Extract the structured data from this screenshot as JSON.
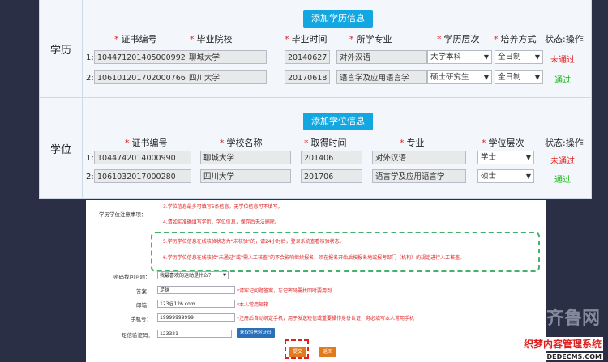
{
  "education": {
    "section_label": "学历",
    "add_button": "添加学历信息",
    "headers": [
      "证书编号",
      "毕业院校",
      "毕业时间",
      "所学专业",
      "学历层次",
      "培养方式",
      "状态:操作"
    ],
    "rows": [
      {
        "num": "1:",
        "cert": "104471201405000992",
        "school": "聊城大学",
        "date": "20140627",
        "major": "对外汉语",
        "level": "大学本科",
        "mode": "全日制",
        "status": "未通过",
        "status_ok": false
      },
      {
        "num": "2:",
        "cert": "106101201702000766",
        "school": "四川大学",
        "date": "20170618",
        "major": "语言学及应用语言学",
        "level": "硕士研究生",
        "mode": "全日制",
        "status": "通过",
        "status_ok": true
      }
    ]
  },
  "degree": {
    "section_label": "学位",
    "add_button": "添加学位信息",
    "headers": [
      "证书编号",
      "学校名称",
      "取得时间",
      "专业",
      "学位层次",
      "状态:操作"
    ],
    "rows": [
      {
        "num": "1:",
        "cert": "1044742014000990",
        "school": "聊城大学",
        "date": "201406",
        "major": "对外汉语",
        "level": "学士",
        "status": "未通过",
        "status_ok": false
      },
      {
        "num": "2:",
        "cert": "1061032017000280",
        "school": "四川大学",
        "date": "201706",
        "major": "语言学及应用语言学",
        "level": "硕士",
        "status": "通过",
        "status_ok": true
      }
    ]
  },
  "form": {
    "notice_label": "学历学位注意事项：",
    "notes": [
      "3.学位信息最多可填写5条信息，无学位信息可不填写。",
      "4.请如实准确填写学历、学位信息，保存后无法删除。",
      "5.学历学位信息在线核验状态为“未核验”的，请24小时后，登录系统查看核验状态。",
      "6.学历学位信息在线核验“未通过”或“需人工核查”的不会影响继续报名，须在报名开始后按报名地或报考部门（机构）的规定进行人工核查。"
    ],
    "question_label": "密码找回问题：",
    "question_value": "我最喜欢的运动是什么？",
    "answer_label": "答案：",
    "answer_value": "足球",
    "answer_hint": "*请牢记问题答案，忘记密码需找回时要用到",
    "email_label": "邮箱：",
    "email_value": "123@126.com",
    "email_hint": "*本人常用邮箱",
    "phone_label": "手机号：",
    "phone_value": "19999999999",
    "phone_hint": "*注册后自动绑定手机，用于发送短信或重要操作身份认证，务必填写本人常用手机",
    "code_label": "短信验证码：",
    "code_value": "123321",
    "get_code_button": "获取短信验证码",
    "submit_button": "提交",
    "back_button": "返回"
  },
  "watermark": {
    "line1": "织梦内容管理系统",
    "line2": "DEDECMS.COM"
  },
  "colors": {
    "accent": "#13a7e2",
    "fail": "#e02020",
    "pass": "#18b518",
    "action": "#e07a1c"
  }
}
